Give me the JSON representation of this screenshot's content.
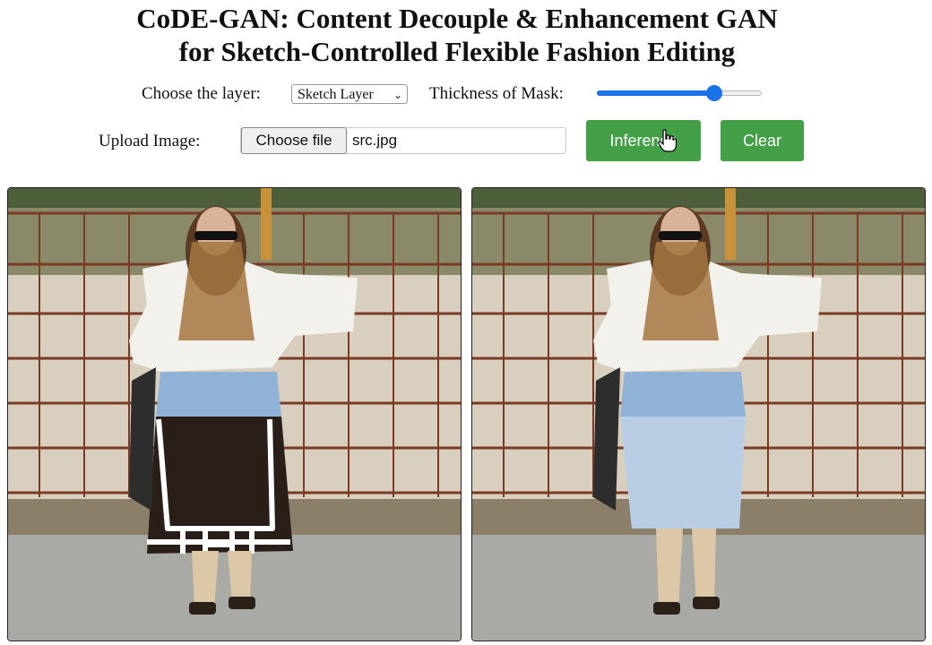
{
  "title": {
    "line1": "CoDE-GAN: Content Decouple & Enhancement GAN",
    "line2": "for Sketch-Controlled Flexible Fashion Editing"
  },
  "controls": {
    "layer_label": "Choose the layer:",
    "layer_selected": "Sketch Layer",
    "thickness_label": "Thickness of Mask:",
    "thickness_level": 0.71,
    "upload_label": "Upload Image:",
    "choose_file_label": "Choose file",
    "file_name": "src.jpg",
    "inference_label": "Inference",
    "clear_label": "Clear"
  },
  "colors": {
    "accent_blue": "#1a73e8",
    "button_green": "#43a047",
    "sketch_mask": "#2a1f18",
    "sketch_stroke": "#ffffff",
    "generated_denim": "#b9cde4"
  },
  "panels": {
    "input": {
      "content": "photo of woman with sketch mask over skirt region"
    },
    "output": {
      "content": "generated photo of woman wearing light denim skirt"
    }
  }
}
